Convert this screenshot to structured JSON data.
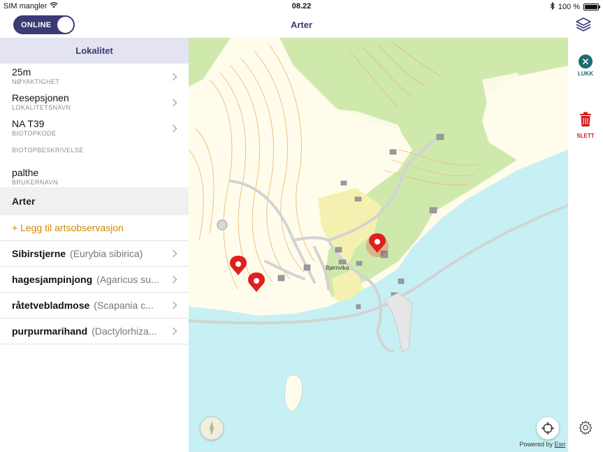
{
  "status_bar": {
    "carrier": "SIM mangler",
    "time": "08.22",
    "battery": "100 %"
  },
  "nav": {
    "toggle_label": "ONLINE",
    "title": "Arter"
  },
  "panel": {
    "header": "Lokalitet",
    "properties": [
      {
        "value": "25m",
        "key": "NØYAKTIGHET"
      },
      {
        "value": "Resepsjonen",
        "key": "LOKALITETSNAVN"
      },
      {
        "value": "NA T39",
        "key": "BIOTOPKODE"
      }
    ],
    "biotope_description_label": "BIOTOPBESKRIVELSE",
    "user": {
      "value": "palthe",
      "key": "BRUKERNAVN"
    },
    "arter_header": "Arter",
    "add_observation": "+ Legg til artsobservasjon",
    "species": [
      {
        "name": "Sibirstjerne",
        "latin": "(Eurybia sibirica)"
      },
      {
        "name": "hagesjampinjong",
        "latin": "(Agaricus su..."
      },
      {
        "name": "råtetvebladmose",
        "latin": "(Scapania c..."
      },
      {
        "name": "purpurmarihand",
        "latin": "(Dactylorhiza..."
      }
    ]
  },
  "map": {
    "place_label": "Bjørnvika",
    "attribution_prefix": "Powered by",
    "attribution_brand": "Esri",
    "colors": {
      "water": "#c6f0f4",
      "forest": "#c9e7a4",
      "open": "#fffbe6",
      "field": "#f5f3b8",
      "contour": "#e6b873"
    }
  },
  "rail": {
    "close_label": "LUKK",
    "delete_label": "SLETT",
    "close_color": "#1b6d72",
    "delete_color": "#d4181c"
  },
  "icons": {
    "wifi": "wifi-icon",
    "bluetooth": "bluetooth-icon",
    "layers": "layers-icon",
    "chevron": "chevron-right-icon",
    "close": "close-icon",
    "trash": "trash-icon",
    "gear": "gear-icon",
    "locate": "crosshair-icon",
    "compass": "compass-icon",
    "pin": "map-pin-icon"
  }
}
